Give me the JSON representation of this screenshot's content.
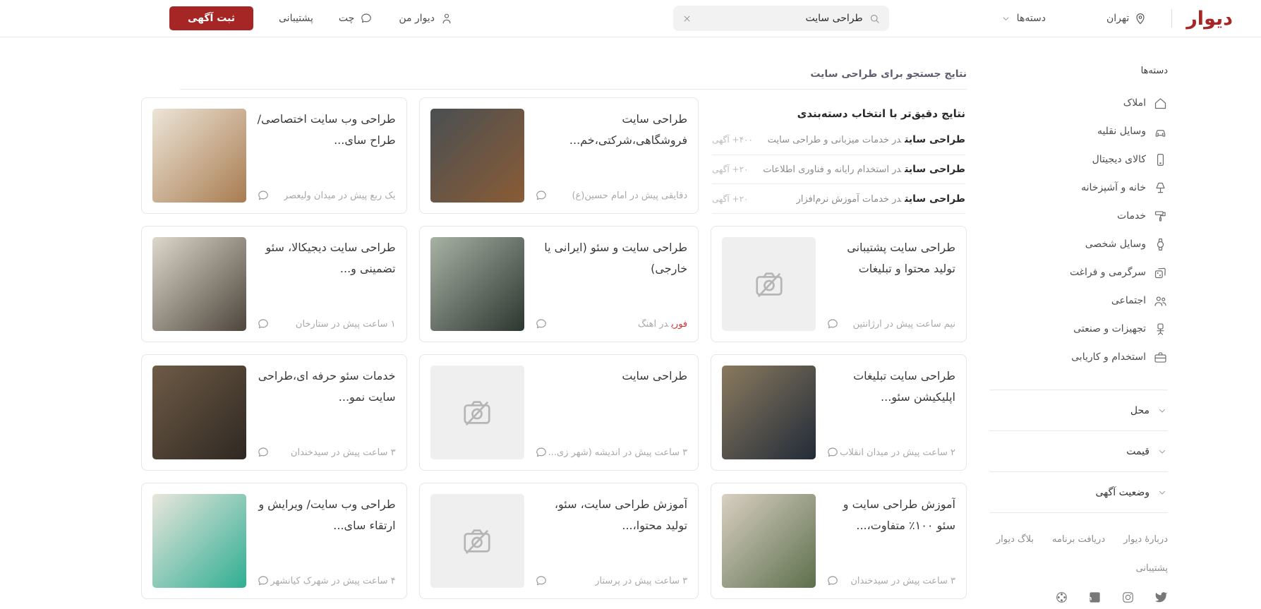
{
  "brand_color": "#a62626",
  "urgent_color": "#d03333",
  "header": {
    "logo": "دیوار",
    "city": "تهران",
    "categories_label": "دسته‌ها",
    "search": {
      "value": "طراحی سایت"
    },
    "my_divar": "دیوار من",
    "chat": "چت",
    "support": "پشتیبانی",
    "post_ad": "ثبت آگهی"
  },
  "sidebar": {
    "title": "دسته‌ها",
    "categories": [
      {
        "label": "املاک",
        "icon": "home-icon"
      },
      {
        "label": "وسایل نقلیه",
        "icon": "car-icon"
      },
      {
        "label": "کالای دیجیتال",
        "icon": "mobile-icon"
      },
      {
        "label": "خانه و آشپزخانه",
        "icon": "lamp-icon"
      },
      {
        "label": "خدمات",
        "icon": "brush-icon"
      },
      {
        "label": "وسایل شخصی",
        "icon": "watch-icon"
      },
      {
        "label": "سرگرمی و فراغت",
        "icon": "dice-icon"
      },
      {
        "label": "اجتماعی",
        "icon": "people-icon"
      },
      {
        "label": "تجهیزات و صنعتی",
        "icon": "chair-icon"
      },
      {
        "label": "استخدام و کاریابی",
        "icon": "briefcase-icon"
      }
    ],
    "filters": [
      {
        "label": "محل"
      },
      {
        "label": "قیمت"
      },
      {
        "label": "وضعیت آگهی"
      }
    ],
    "footer_links": [
      "دربارهٔ دیوار",
      "دریافت برنامه",
      "بلاگ دیوار"
    ],
    "support_link": "پشتیبانی",
    "social": [
      "twitter-icon",
      "instagram-icon",
      "linkedin-icon",
      "aparat-icon"
    ]
  },
  "results": {
    "title": "نتایج جستجو برای طراحی سایت",
    "suggestion": {
      "title": "نتایج دقیق‌تر با انتخاب دسته‌بندی",
      "rows": [
        {
          "keyword": "طراحی سایت",
          "context": "در خدمات میزبانی و طراحی سایت",
          "count": "۴۰۰+ آگهی"
        },
        {
          "keyword": "طراحی سایت",
          "context": "در استخدام رایانه و فناوری اطلاعات",
          "count": "۲۰+ آگهی"
        },
        {
          "keyword": "طراحی سایت",
          "context": "در خدمات آموزش نرم‌افزار",
          "count": "۲۰+ آگهی"
        }
      ]
    },
    "cards": [
      {
        "title": "طراحی سایت فروشگاهی،شرکتی،خم...",
        "meta": "دقایقی پیش در امام حسین(ع)",
        "thumb": [
          "#4a4f52",
          "#8a5c35"
        ]
      },
      {
        "title": "طراحی وب سایت اختصاصی/طراح سای...",
        "meta": "یک ربع پیش در میدان ولیعصر",
        "thumb": [
          "#ece5d8",
          "#a97c50"
        ]
      },
      {
        "title": "طراحی سایت پشتیبانی تولید محتوا و تبلیغات",
        "meta": "نیم ساعت پیش در آرژانتین",
        "thumb": null
      },
      {
        "title": "طراحی سایت و سئو (ایرانی یا خارجی)",
        "urgent_label": "فوری",
        "meta": "در آهنگ",
        "thumb": [
          "#a8b2a4",
          "#2c3630"
        ]
      },
      {
        "title": "طراحی سایت دیجیکالا، سئو تضمینی و...",
        "meta": "۱ ساعت پیش در ستارخان",
        "thumb": [
          "#ddd8cc",
          "#4e463c"
        ]
      },
      {
        "title": "طراحی سایت تبلیغات اپلیکیشن سئو...",
        "meta": "۲ ساعت پیش در میدان انقلاب",
        "thumb": [
          "#8a7a5e",
          "#222b38"
        ]
      },
      {
        "title": "طراحی سایت",
        "meta": "۳ ساعت پیش در اندیشه (شهر زی...",
        "thumb": null
      },
      {
        "title": "خدمات سئو حرفه ای،طراحی سایت نمو...",
        "meta": "۳ ساعت پیش در سیدخندان",
        "thumb": [
          "#6e5b46",
          "#2f2822"
        ]
      },
      {
        "title": "آموزش طراحی سایت و سئو ۱۰۰٪ متفاوت،...",
        "meta": "۳ ساعت پیش در سیدخندان",
        "thumb": [
          "#d9d0c3",
          "#5d6f4c"
        ]
      },
      {
        "title": "آموزش طراحی سایت، سئو، تولید محتوا،...",
        "meta": "۳ ساعت پیش در پرستار",
        "thumb": null
      },
      {
        "title": "طراحی وب سایت/ ویرایش و ارتقاء سای...",
        "meta": "۴ ساعت پیش در شهرک کیانشهر",
        "thumb": [
          "#eae6dc",
          "#2fae93"
        ]
      }
    ]
  }
}
